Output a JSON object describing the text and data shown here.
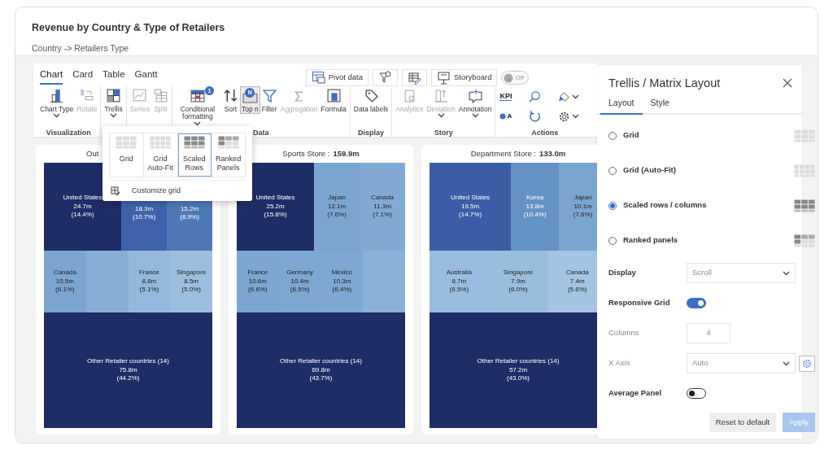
{
  "header": {
    "title": "Revenue by Country & Type of Retailers",
    "subtitle": "Country -> Retailers Type"
  },
  "ribbon": {
    "tabs": [
      {
        "label": "Chart",
        "selected": true
      },
      {
        "label": "Card",
        "selected": false
      },
      {
        "label": "Table",
        "selected": false
      },
      {
        "label": "Gantt",
        "selected": false
      }
    ],
    "tools": [
      {
        "kind": "button",
        "label": "Pivot data"
      },
      {
        "kind": "icon"
      },
      {
        "kind": "icon"
      },
      {
        "kind": "button",
        "label": "Storyboard"
      },
      {
        "kind": "toggle",
        "label": "Off",
        "on": false
      }
    ],
    "groups": [
      {
        "label": "Visualization",
        "items": [
          {
            "label": "Chart Type",
            "disabled": false,
            "selected": false,
            "dropdown": true
          },
          {
            "label": "Rotate",
            "disabled": true,
            "selected": false,
            "dropdown": false
          }
        ]
      },
      {
        "items": [
          {
            "label": "Trellis",
            "disabled": false,
            "selected": false,
            "dropdown": true
          }
        ]
      },
      {
        "items": [
          {
            "label": "Series",
            "disabled": true,
            "selected": false,
            "dropdown": false
          },
          {
            "label": "Split",
            "disabled": true,
            "selected": false,
            "dropdown": false
          }
        ]
      },
      {
        "label": "Data",
        "items": [
          {
            "label": "Conditional formatting",
            "disabled": false,
            "selected": false,
            "dropdown": true,
            "badge": "1"
          },
          {
            "label": "Sort",
            "disabled": false,
            "selected": false,
            "dropdown": false
          },
          {
            "label": "Top n",
            "disabled": false,
            "selected": true,
            "dropdown": false,
            "badge": "N"
          },
          {
            "label": "Filter",
            "disabled": false,
            "selected": false,
            "dropdown": false
          },
          {
            "label": "Aggregation",
            "disabled": true,
            "selected": false,
            "dropdown": false
          },
          {
            "label": "Formula",
            "disabled": false,
            "selected": false,
            "dropdown": false
          }
        ]
      },
      {
        "label": "Display",
        "items": [
          {
            "label": "Data labels",
            "disabled": false,
            "selected": false,
            "dropdown": false
          }
        ]
      },
      {
        "label": "Story",
        "items": [
          {
            "label": "Analytics",
            "disabled": true,
            "selected": false,
            "dropdown": false
          },
          {
            "label": "Deviation",
            "disabled": true,
            "selected": false,
            "dropdown": true
          },
          {
            "label": "Annotation",
            "disabled": false,
            "selected": false,
            "dropdown": true
          }
        ]
      }
    ],
    "actions": {
      "label": "Actions",
      "items": [
        {
          "kind": "text",
          "label": "KPI",
          "dropdown": false
        },
        {
          "kind": "icon",
          "dropdown": false
        },
        {
          "kind": "icon",
          "dropdown": true
        },
        {
          "kind": "dot-text",
          "label": "A",
          "dropdown": false
        },
        {
          "kind": "icon",
          "dropdown": false
        },
        {
          "kind": "icon",
          "dropdown": true
        }
      ]
    }
  },
  "trellis_menu": {
    "options": [
      {
        "label": "Grid",
        "selected": false
      },
      {
        "label": "Grid Auto-Fit",
        "selected": false
      },
      {
        "label": "Scaled Rows",
        "selected": true
      },
      {
        "label": "Ranked Panels",
        "selected": false
      }
    ],
    "customize": "Customize grid"
  },
  "panels": [
    {
      "title": "Out",
      "top": [
        {
          "name": "United States",
          "value": "24.7m",
          "share": "(14.4%)",
          "color": "#1f2d66"
        },
        {
          "value": "18.3m",
          "share": "(10.7%)",
          "color": "#3e63ab"
        },
        {
          "value": "15.2m",
          "share": "(8.9%)",
          "color": "#4f79b6"
        }
      ],
      "middle": [
        {
          "name": "Canada",
          "value": "10.5m",
          "share": "(6.1%)",
          "color": "#7aa5cf"
        },
        {
          "color": "#86aed5"
        },
        {
          "name": "France",
          "value": "8.8m",
          "share": "(5.1%)",
          "color": "#93b8dc"
        },
        {
          "name": "Singapore",
          "value": "8.5m",
          "share": "(5.0%)",
          "color": "#9bbedf"
        }
      ],
      "other": {
        "name": "Other Retailer countries (14)",
        "value": "75.8m",
        "share": "(44.2%)",
        "color": "#1f2d66"
      }
    },
    {
      "title": "Sports Store :",
      "total": "159.9m",
      "top": [
        {
          "name": "United States",
          "value": "25.2m",
          "share": "(15.8%)",
          "color": "#1f2d66"
        },
        {
          "name": "Japan",
          "value": "12.1m",
          "share": "(7.6%)",
          "color": "#7aa5cf"
        },
        {
          "name": "Canada",
          "value": "11.3m",
          "share": "(7.1%)",
          "color": "#80aad2"
        }
      ],
      "middle": [
        {
          "name": "France",
          "value": "10.6m",
          "share": "(6.6%)",
          "color": "#7aa6d0"
        },
        {
          "name": "Germany",
          "value": "10.4m",
          "share": "(6.5%)",
          "color": "#7ba7d0"
        },
        {
          "name": "Mexico",
          "value": "10.3m",
          "share": "(6.4%)",
          "color": "#7ca8d1"
        },
        {
          "color": "#8ab1d7"
        }
      ],
      "other": {
        "name": "Other Retailer countries (14)",
        "value": "69.8m",
        "share": "(43.7%)",
        "color": "#1f2d66"
      }
    },
    {
      "title": "Department Store :",
      "total": "133.0m",
      "top": [
        {
          "name": "United States",
          "value": "19.5m",
          "share": "(14.7%)",
          "color": "#3a5da6"
        },
        {
          "name": "Korea",
          "value": "13.8m",
          "share": "(10.4%)",
          "color": "#6592c4"
        },
        {
          "name": "Japan",
          "value": "10.1m",
          "share": "(7.6%)",
          "color": "#7aa5cf"
        }
      ],
      "middle": [
        {
          "name": "Australia",
          "value": "8.7m",
          "share": "(6.5%)",
          "color": "#98bcdd"
        },
        {
          "name": "Singapore",
          "value": "7.9m",
          "share": "(6.0%)",
          "color": "#99bddd"
        },
        {
          "name": "Canada",
          "value": "7.4m",
          "share": "(5.6%)",
          "color": "#a3c4e2"
        }
      ],
      "other": {
        "name": "Other Retailer countries (14)",
        "value": "57.2m",
        "share": "(43.0%)",
        "color": "#1f2d66"
      }
    }
  ],
  "settings": {
    "title": "Trellis / Matrix Layout",
    "tabs": [
      {
        "label": "Layout",
        "selected": true
      },
      {
        "label": "Style",
        "selected": false
      }
    ],
    "layouts": [
      {
        "label": "Grid",
        "selected": false
      },
      {
        "label": "Grid (Auto-Fit)",
        "selected": false
      },
      {
        "label": "Scaled rows / columns",
        "selected": true
      },
      {
        "label": "Ranked panels",
        "selected": false
      }
    ],
    "fields": [
      {
        "kind": "select",
        "label": "Display",
        "value": "Scroll",
        "disabled": false
      },
      {
        "kind": "toggle",
        "label": "Responsive Grid",
        "on": true,
        "disabled": false
      },
      {
        "kind": "number",
        "label": "Columns",
        "value": "4",
        "disabled": true
      },
      {
        "kind": "select-gear",
        "label": "X Axis",
        "value": "Auto",
        "disabled": true
      },
      {
        "kind": "toggle",
        "label": "Average Panel",
        "on": false,
        "disabled": false
      }
    ],
    "buttons": [
      {
        "label": "Reset to default",
        "primary": false
      },
      {
        "label": "Apply",
        "primary": true
      }
    ]
  }
}
